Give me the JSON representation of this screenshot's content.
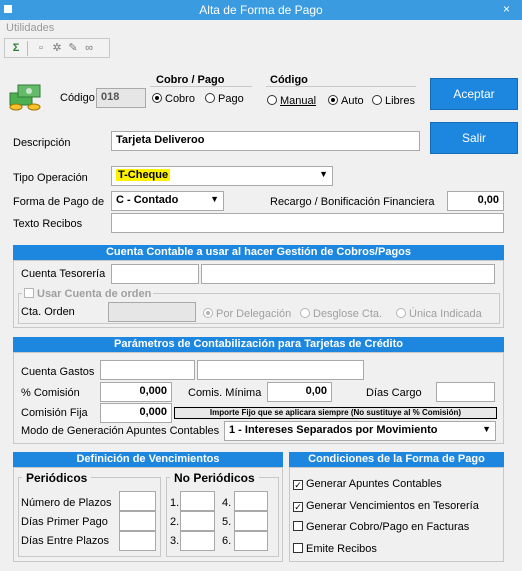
{
  "window": {
    "title": "Alta de Forma de Pago",
    "close": "×"
  },
  "menu": {
    "utilidades": "Utilidades"
  },
  "header": {
    "codigo_label": "Código",
    "codigo_value": "018",
    "cobro_pago": {
      "title": "Cobro / Pago",
      "cobro": "Cobro",
      "pago": "Pago",
      "selected": "cobro"
    },
    "codigo_mode": {
      "title": "Código",
      "manual": "Manual",
      "auto": "Auto",
      "libres": "Libres",
      "selected": "auto"
    },
    "aceptar": "Aceptar",
    "salir": "Salir"
  },
  "form": {
    "descripcion_label": "Descripción",
    "descripcion_value": "Tarjeta Deliveroo",
    "tipo_operacion_label": "Tipo Operación",
    "tipo_operacion_value": "T-Cheque",
    "forma_pago_label": "Forma de Pago de",
    "forma_pago_value": "C - Contado",
    "recargo_label": "Recargo / Bonificación Financiera",
    "recargo_value": "0,00",
    "texto_recibos_label": "Texto Recibos",
    "texto_recibos_value": ""
  },
  "cuenta_contable": {
    "header": "Cuenta Contable a usar al hacer Gestión de Cobros/Pagos",
    "tesoreria_label": "Cuenta Tesorería",
    "usar_orden_label": "Usar Cuenta de orden",
    "cta_orden_label": "Cta. Orden",
    "por_delegacion": "Por Delegación",
    "desglose": "Desglose Cta.",
    "unica": "Única Indicada"
  },
  "parametros": {
    "header": "Parámetros de Contabilización para Tarjetas de Crédito",
    "cuenta_gastos_label": "Cuenta Gastos",
    "comision_label": "% Comisión",
    "comision_value": "0,000",
    "comis_minima_label": "Comis. Mínima",
    "comis_minima_value": "0,00",
    "dias_cargo_label": "Días Cargo",
    "comision_fija_label": "Comisión Fija",
    "comision_fija_value": "0,000",
    "importe_fijo_note": "Importe Fijo que se aplicara siempre (No sustituye al % Comisión)",
    "modo_label": "Modo de Generación Apuntes Contables",
    "modo_value": "1 - Intereses Separados por Movimiento"
  },
  "vencimientos": {
    "header": "Definición de Vencimientos",
    "periodicos_label": "Periódicos",
    "no_periodicos_label": "No Periódicos",
    "num_plazos_label": "Número de Plazos",
    "dias_primer_label": "Días Primer Pago",
    "dias_entre_label": "Días Entre Plazos",
    "slots": [
      "1.",
      "2.",
      "3.",
      "4.",
      "5.",
      "6."
    ]
  },
  "condiciones": {
    "header": "Condiciones de la Forma de Pago",
    "generar_apuntes": "Generar Apuntes Contables",
    "generar_vencimientos": "Generar Vencimientos en Tesorería",
    "generar_cobro": "Generar Cobro/Pago en Facturas",
    "emite_recibos": "Emite Recibos"
  },
  "colors": {
    "accent": "#1d86de",
    "titlebar": "#3a9be0",
    "highlight": "#fff200"
  }
}
